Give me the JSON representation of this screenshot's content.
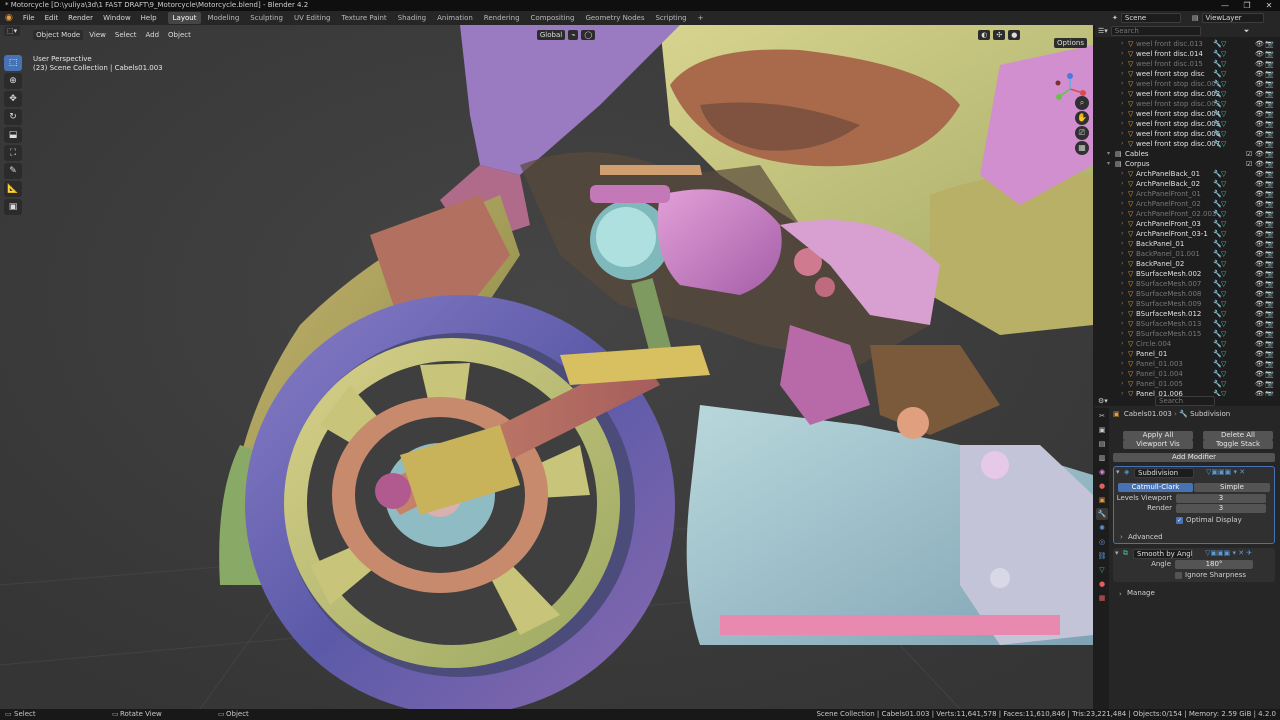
{
  "window": {
    "title": "* Motorcycle [D:\\yuliya\\3d\\1 FAST DRAFT\\9_Motorcycle\\Motorcycle.blend] - Blender 4.2",
    "controls": [
      "—",
      "❐",
      "✕"
    ]
  },
  "menus": [
    "File",
    "Edit",
    "Render",
    "Window",
    "Help"
  ],
  "workspaces": [
    "Layout",
    "Modeling",
    "Sculpting",
    "UV Editing",
    "Texture Paint",
    "Shading",
    "Animation",
    "Rendering",
    "Compositing",
    "Geometry Nodes",
    "Scripting",
    "+"
  ],
  "active_workspace": "Layout",
  "scene": {
    "scene_name": "Scene",
    "view_layer": "ViewLayer"
  },
  "viewport": {
    "mode": "Object Mode",
    "menus": [
      "View",
      "Select",
      "Add",
      "Object"
    ],
    "orientation": "Global",
    "info_line1": "User Perspective",
    "info_line2": "(23) Scene Collection | Cabels01.003",
    "options_label": "Options"
  },
  "outliner": {
    "search_placeholder": "Search",
    "rows": [
      {
        "label": "weel front disc.013",
        "dim": true
      },
      {
        "label": "weel front disc.014",
        "dim": false
      },
      {
        "label": "weel front disc.015",
        "dim": true
      },
      {
        "label": "weel front stop disc",
        "dim": false
      },
      {
        "label": "weel front stop disc.001",
        "dim": true
      },
      {
        "label": "weel front stop disc.002",
        "dim": false
      },
      {
        "label": "weel front stop disc.003",
        "dim": true
      },
      {
        "label": "weel front stop disc.004",
        "dim": false
      },
      {
        "label": "weel front stop disc.005",
        "dim": false
      },
      {
        "label": "weel front stop disc.006",
        "dim": false
      },
      {
        "label": "weel front stop disc.007",
        "dim": false
      },
      {
        "label": "Cables",
        "dim": false,
        "collection": true
      },
      {
        "label": "Corpus",
        "dim": false,
        "collection": true
      },
      {
        "label": "ArchPanelBack_01",
        "dim": false
      },
      {
        "label": "ArchPanelBack_02",
        "dim": false
      },
      {
        "label": "ArchPanelFront_01",
        "dim": true
      },
      {
        "label": "ArchPanelFront_02",
        "dim": true
      },
      {
        "label": "ArchPanelFront_02.003",
        "dim": true
      },
      {
        "label": "ArchPanelFront_03",
        "dim": false
      },
      {
        "label": "ArchPanelFront_03-1",
        "dim": false
      },
      {
        "label": "BackPanel_01",
        "dim": false
      },
      {
        "label": "BackPanel_01.001",
        "dim": true
      },
      {
        "label": "BackPanel_02",
        "dim": false
      },
      {
        "label": "BSurfaceMesh.002",
        "dim": false
      },
      {
        "label": "BSurfaceMesh.007",
        "dim": true
      },
      {
        "label": "BSurfaceMesh.008",
        "dim": true
      },
      {
        "label": "BSurfaceMesh.009",
        "dim": true
      },
      {
        "label": "BSurfaceMesh.012",
        "dim": false
      },
      {
        "label": "BSurfaceMesh.013",
        "dim": true
      },
      {
        "label": "BSurfaceMesh.015",
        "dim": true
      },
      {
        "label": "Circle.004",
        "dim": true
      },
      {
        "label": "Panel_01",
        "dim": false
      },
      {
        "label": "Panel_01.003",
        "dim": true
      },
      {
        "label": "Panel_01.004",
        "dim": true
      },
      {
        "label": "Panel_01.005",
        "dim": true
      },
      {
        "label": "Panel_01.006",
        "dim": false
      }
    ]
  },
  "properties": {
    "search_placeholder": "Search",
    "breadcrumb_object": "Cabels01.003",
    "breadcrumb_modifier": "Subdivision",
    "apply_all": "Apply All",
    "delete_all": "Delete All",
    "viewport_vis": "Viewport Vis",
    "toggle_stack": "Toggle Stack",
    "add_modifier": "Add Modifier",
    "subdivision": {
      "name": "Subdivision",
      "type_a": "Catmull-Clark",
      "type_b": "Simple",
      "levels_viewport_label": "Levels Viewport",
      "levels_viewport": "3",
      "render_label": "Render",
      "render": "3",
      "optimal_display": "Optimal Display",
      "advanced": "Advanced"
    },
    "smooth": {
      "name": "Smooth by Angle",
      "angle_label": "Angle",
      "angle": "180°",
      "ignore_sharpness": "Ignore Sharpness",
      "manage": "Manage"
    }
  },
  "statusbar": {
    "select": "Select",
    "rotate": "Rotate View",
    "object": "Object",
    "stats": "Scene Collection | Cabels01.003 | Verts:11,641,578 | Faces:11,610,846 | Tris:23,221,484 | Objects:0/154 | Memory: 2.59 GiB | 4.2.0"
  },
  "colors": {
    "accent": "#4772b3",
    "viewport_bg": "#3d3d3d",
    "object_orange": "#e89b3a",
    "modifier_blue": "#5b9bd5",
    "mesh_green": "#4fc08d"
  }
}
